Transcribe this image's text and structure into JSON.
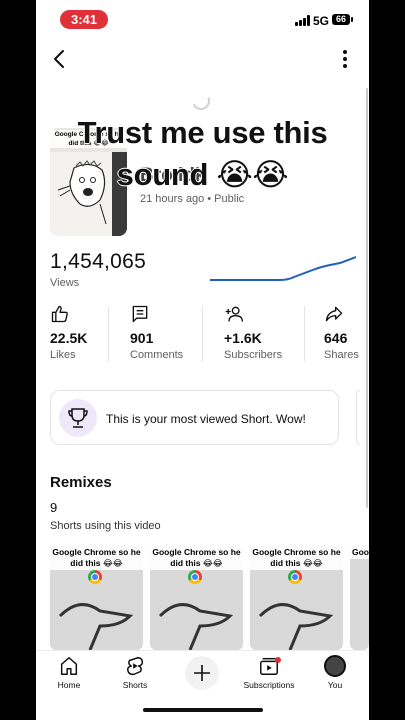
{
  "status_bar": {
    "time": "3:41",
    "network": "5G",
    "battery": "66"
  },
  "video": {
    "overlay_text": "Trust me use this sound 😭😭",
    "thumbnail_caption": "Google Chrome so he did this 😂😂",
    "title": "Bro idk",
    "meta": "21 hours ago • Public"
  },
  "views": {
    "count": "1,454,065",
    "label": "Views"
  },
  "stats": [
    {
      "value": "22.5K",
      "label": "Likes",
      "icon": "thumbs-up-icon"
    },
    {
      "value": "901",
      "label": "Comments",
      "icon": "comment-icon"
    },
    {
      "value": "+1.6K",
      "label": "Subscribers",
      "icon": "add-person-icon"
    },
    {
      "value": "646",
      "label": "Shares",
      "icon": "share-icon"
    }
  ],
  "achievement": {
    "text": "This is your most viewed Short. Wow!",
    "icon": "trophy-icon"
  },
  "remixes": {
    "title": "Remixes",
    "count": "9",
    "subtitle": "Shorts using this video",
    "items": [
      {
        "caption": "Google Chrome so he did this 😂😂"
      },
      {
        "caption": "Google Chrome so he did this 😂😂"
      },
      {
        "caption": "Google Chrome so he did this 😂😂"
      },
      {
        "caption": "Goo"
      }
    ]
  },
  "bottom_nav": {
    "items": [
      {
        "label": "Home",
        "icon": "home-icon"
      },
      {
        "label": "Shorts",
        "icon": "shorts-icon"
      },
      {
        "label": "",
        "icon": "plus-icon"
      },
      {
        "label": "Subscriptions",
        "icon": "subscriptions-icon"
      },
      {
        "label": "You",
        "icon": "avatar"
      }
    ]
  },
  "colors": {
    "status_pill": "#e0313a",
    "sparkline": "#1f5fc2",
    "achievement_icon_bg": "#efe8fb"
  }
}
